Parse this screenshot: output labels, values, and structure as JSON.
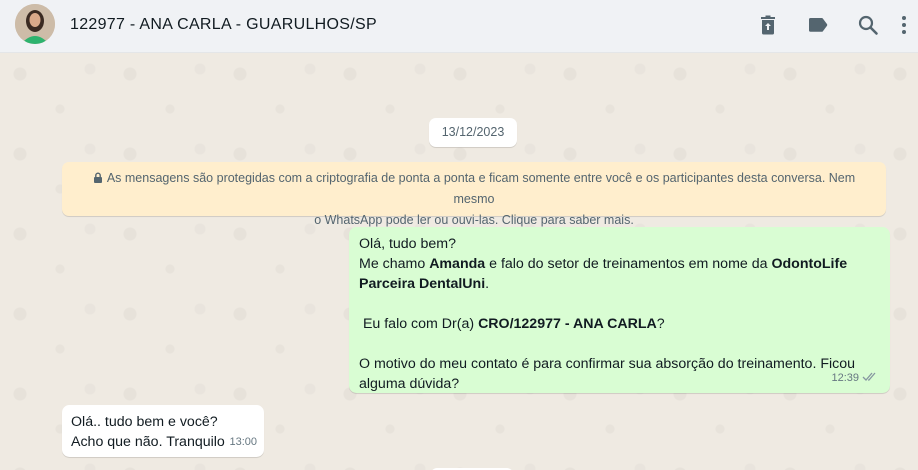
{
  "header": {
    "contact_name": "122977 - ANA CARLA - GUARULHOS/SP",
    "icons": [
      "trash-icon",
      "label-icon",
      "search-icon",
      "menu-icon"
    ]
  },
  "chat": {
    "date": "13/12/2023",
    "encryption_line1": "As mensagens são protegidas com a criptografia de ponta a ponta e ficam somente entre você e os participantes desta conversa. Nem mesmo",
    "encryption_line2": "o WhatsApp pode ler ou ouvi-las. Clique para saber mais.",
    "outgoing": {
      "l1": "Olá, tudo bem?",
      "l2a": "Me chamo ",
      "l2b": "Amanda",
      "l2c": " e falo do setor de treinamentos em nome da ",
      "l2d": "OdontoLife",
      "l3": "Parceira DentalUni",
      "l3end": ".",
      "l5a": " Eu falo com Dr(a) ",
      "l5b": "CRO/122977 - ANA CARLA",
      "l5c": "?",
      "l7": "O motivo do meu contato é para confirmar sua absorção do treinamento. Ficou",
      "l8": "alguma dúvida?",
      "time": "12:39"
    },
    "incoming": {
      "l1": "Olá.. tudo bem e você?",
      "l2": "Acho que não. Tranquilo",
      "time": "13:00"
    }
  },
  "colors": {
    "header_bg": "#f0f2f5",
    "chat_bg": "#efeae2",
    "outgoing_bubble": "#d9fdd3",
    "incoming_bubble": "#ffffff",
    "system_notice": "#ffeecd"
  }
}
